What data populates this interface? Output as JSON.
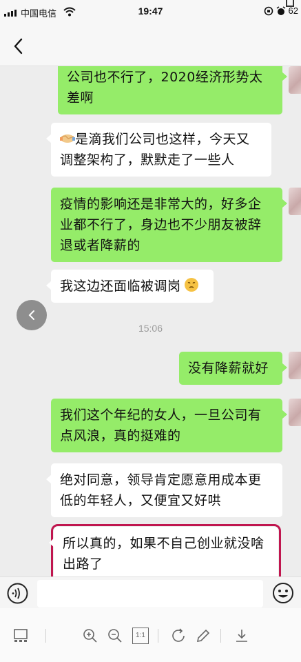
{
  "status_bar": {
    "carrier": "中国电信",
    "time": "19:47",
    "battery": "62"
  },
  "chat": {
    "messages": [
      {
        "side": "me",
        "text_lines": [
          "公司也不行了，2020经济形势太",
          "差啊"
        ]
      },
      {
        "side": "them",
        "emoji": "handshake",
        "text_lines": [
          "是滴我们公司也这样，今天又",
          "调整架构了，默默走了一些人"
        ]
      },
      {
        "side": "me",
        "text_lines": [
          "疫情的影响还是非常大的，好多企",
          "业都不行了，身边也不少朋友被辞",
          "退或者降薪的"
        ]
      },
      {
        "side": "them",
        "text_lines": [
          "我这边还面临被调岗"
        ],
        "emoji_after": "worried-face"
      },
      {
        "side": "me",
        "text_lines": [
          "没有降薪就好"
        ]
      },
      {
        "side": "me",
        "text_lines": [
          "我们这个年纪的女人，一旦公司有",
          "点风浪，真的挺难的"
        ]
      },
      {
        "side": "them",
        "text_lines": [
          "绝对同意，领导肯定愿意用成本更",
          "低的年轻人，又便宜又好哄"
        ]
      },
      {
        "side": "them",
        "highlighted": true,
        "text_lines": [
          "所以真的，如果不自己创业就没啥",
          "出路了"
        ]
      }
    ],
    "timestamp": "15:06"
  },
  "colors": {
    "my_bubble": "#95ec69",
    "their_bubble": "#ffffff",
    "highlight_border": "#c0164f",
    "background": "#ededed"
  },
  "icons": {
    "back": "back-chevron-icon",
    "side_back": "side-back-arrow-icon",
    "voice": "voice-icon",
    "emoji": "emoji-smiley-icon",
    "toolbar": [
      "thumbnails-icon",
      "zoom-in-icon",
      "zoom-out-icon",
      "actual-size-icon",
      "rotate-icon",
      "edit-icon",
      "download-icon"
    ]
  },
  "toolbar": {
    "actual_size_label": "1:1"
  }
}
